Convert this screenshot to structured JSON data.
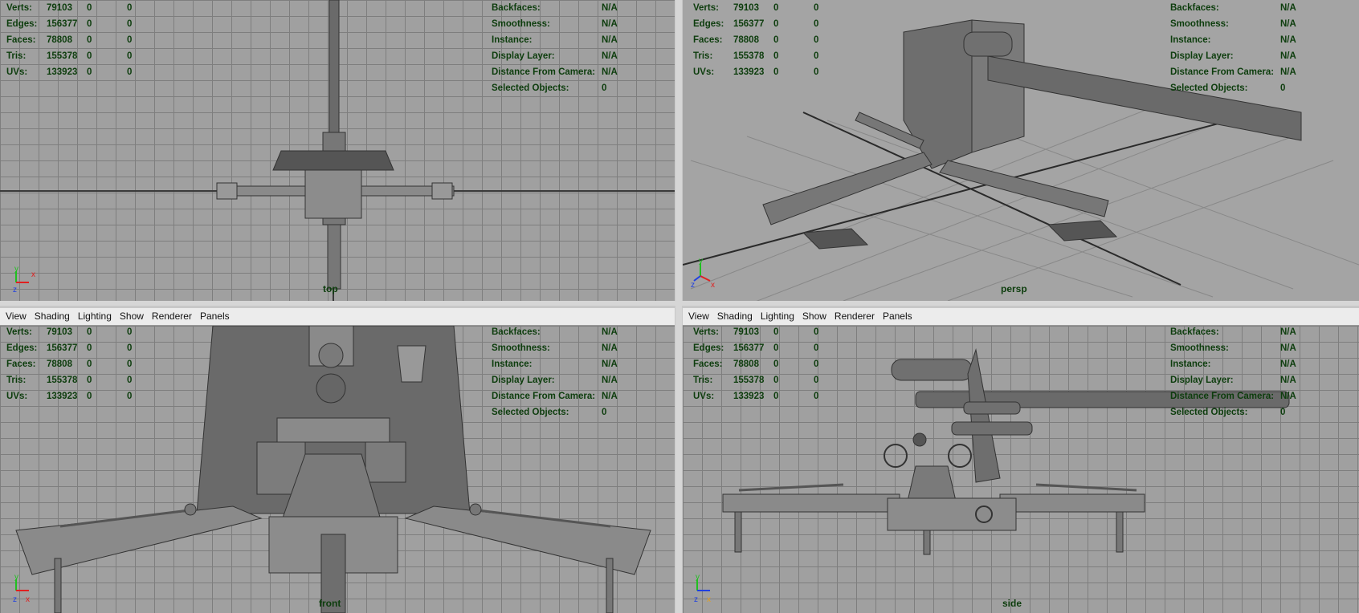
{
  "menu": [
    "View",
    "Shading",
    "Lighting",
    "Show",
    "Renderer",
    "Panels"
  ],
  "hud_left": [
    {
      "key": "Verts:",
      "v1": "79103",
      "v2": "0",
      "v3": "0"
    },
    {
      "key": "Edges:",
      "v1": "156377",
      "v2": "0",
      "v3": "0"
    },
    {
      "key": "Faces:",
      "v1": "78808",
      "v2": "0",
      "v3": "0"
    },
    {
      "key": "Tris:",
      "v1": "155378",
      "v2": "0",
      "v3": "0"
    },
    {
      "key": "UVs:",
      "v1": "133923",
      "v2": "0",
      "v3": "0"
    }
  ],
  "hud_right": [
    {
      "key": "Backfaces:",
      "value": "N/A"
    },
    {
      "key": "Smoothness:",
      "value": "N/A"
    },
    {
      "key": "Instance:",
      "value": "N/A"
    },
    {
      "key": "Display Layer:",
      "value": "N/A"
    },
    {
      "key": "Distance From Camera:",
      "value": "N/A"
    },
    {
      "key": "Selected Objects:",
      "value": "0"
    }
  ],
  "viewports": {
    "top": {
      "camera": "top"
    },
    "persp": {
      "camera": "persp"
    },
    "front": {
      "camera": "front"
    },
    "side": {
      "camera": "side"
    }
  },
  "axis_labels": {
    "x": "x",
    "y": "y",
    "z": "z"
  },
  "colors": {
    "hud_text": "#0d3d0d",
    "grid_line": "#7e7e7e",
    "canvas": "#a0a0a0",
    "x_axis": "#e02020",
    "y_axis": "#20c020",
    "z_axis": "#2040e0"
  }
}
